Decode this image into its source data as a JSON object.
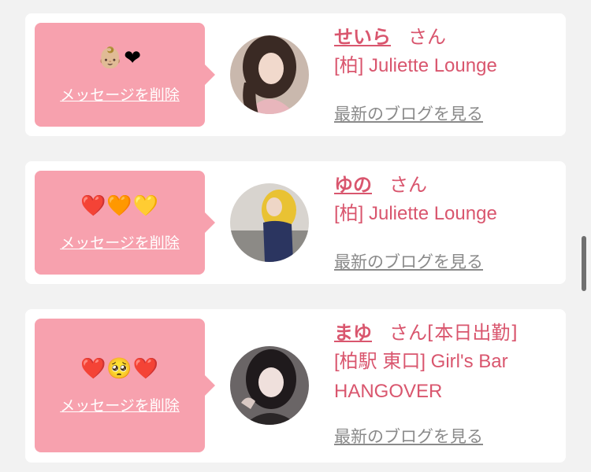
{
  "cards": [
    {
      "emoji": "👶🏼❤",
      "delete_label": "メッセージを削除",
      "name": "せいら",
      "honorific": "さん",
      "status": "",
      "shop_lines": [
        "[柏] Juliette Lounge"
      ],
      "blog_label": "最新のブログを見る"
    },
    {
      "emoji": "❤️🧡💛",
      "delete_label": "メッセージを削除",
      "name": "ゆの",
      "honorific": "さん",
      "status": "",
      "shop_lines": [
        "[柏] Juliette Lounge"
      ],
      "blog_label": "最新のブログを見る"
    },
    {
      "emoji": "❤️🥺❤️",
      "delete_label": "メッセージを削除",
      "name": "まゆ",
      "honorific": "さん",
      "status": "[本日出勤]",
      "shop_lines": [
        "[柏駅 東口] Girl's Bar",
        "HANGOVER"
      ],
      "blog_label": "最新のブログを見る"
    }
  ],
  "colors": {
    "bubble": "#f7a1ae",
    "accent": "#d9566e",
    "link_gray": "#8a8a8a",
    "background": "#f2f2f2"
  }
}
